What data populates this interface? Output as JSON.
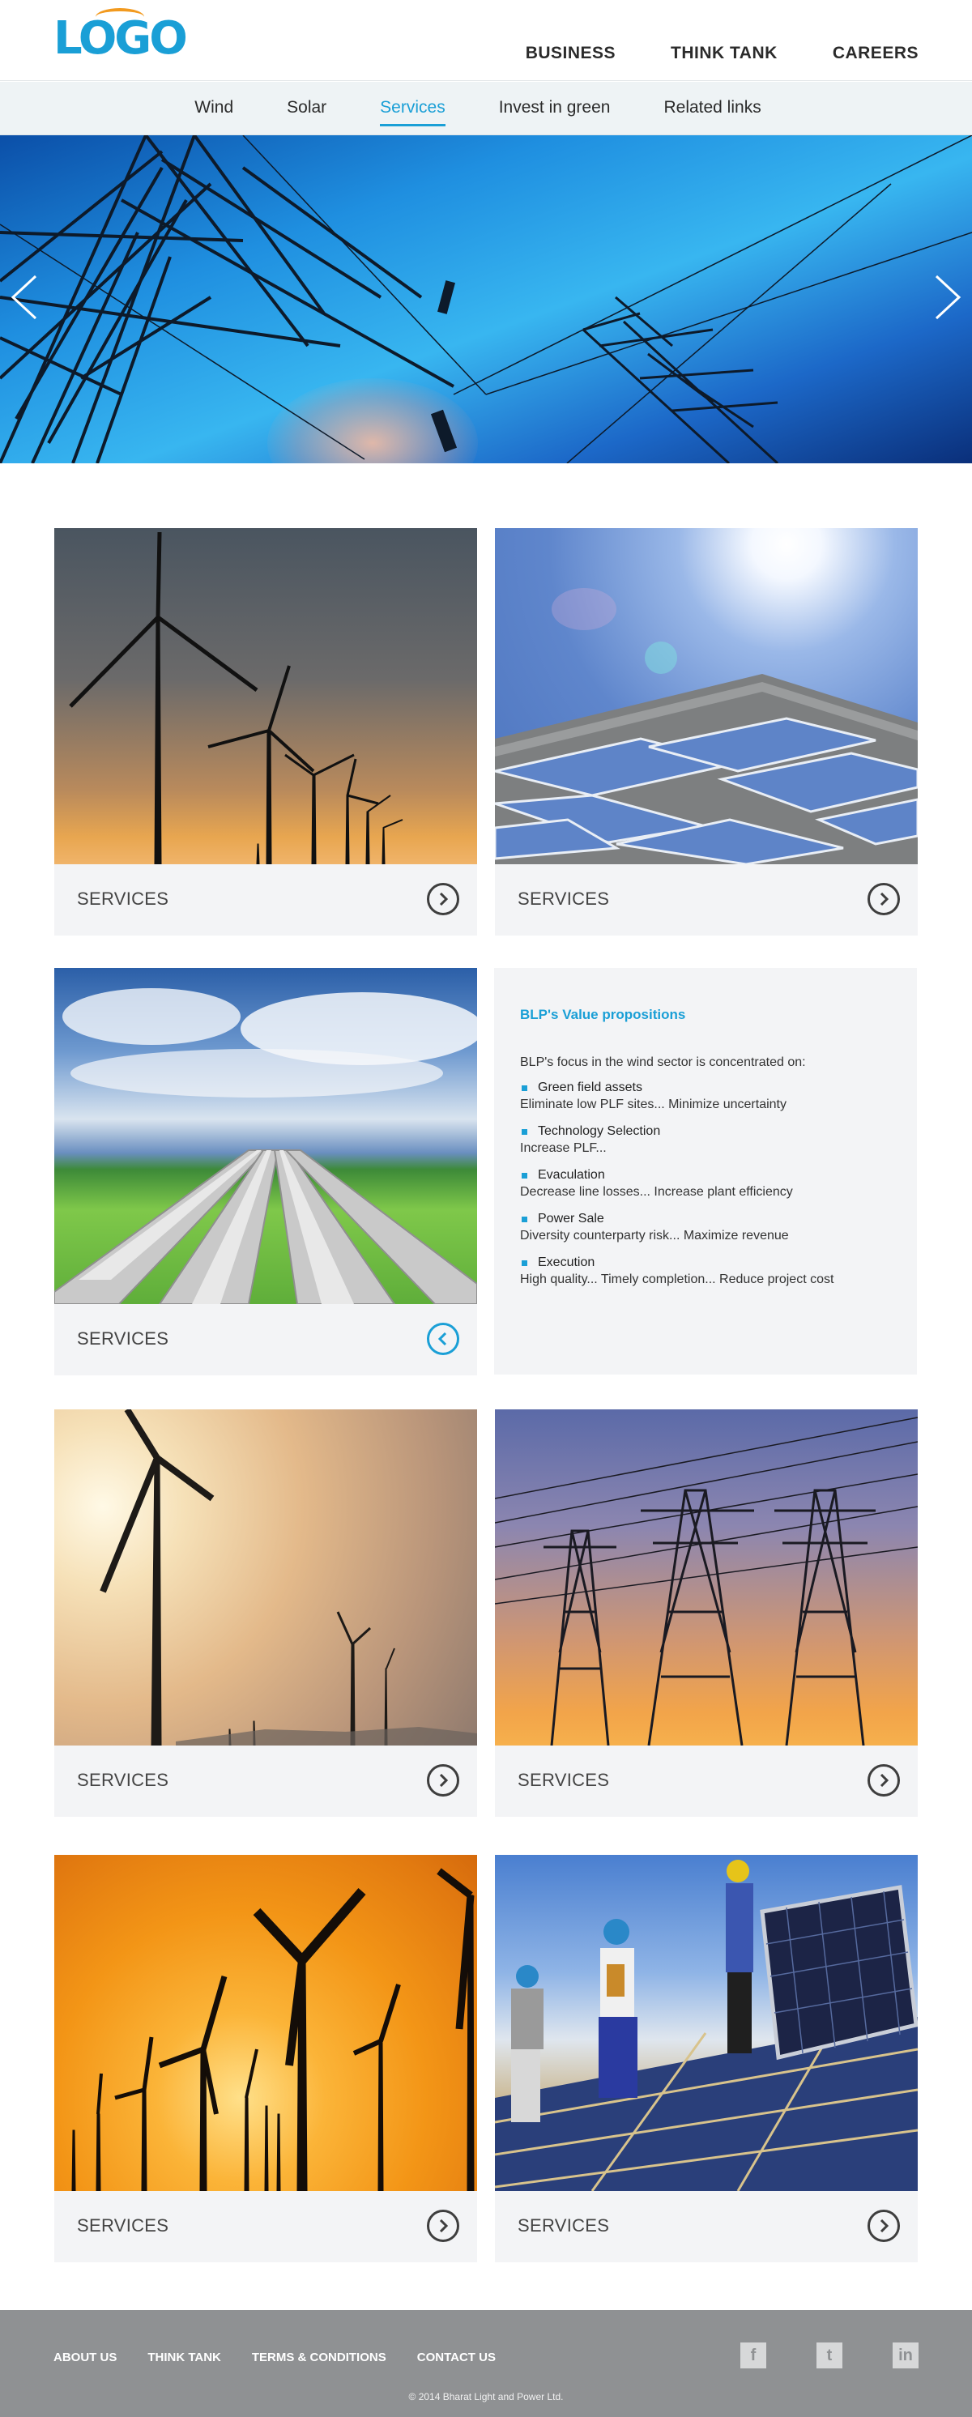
{
  "brand": {
    "logo_text": "LOGO",
    "primary_color": "#1a9fd6",
    "accent_color": "#f29a1f"
  },
  "top_nav": {
    "items": [
      "BUSINESS",
      "THINK TANK",
      "CAREERS"
    ]
  },
  "sub_nav": {
    "items": [
      "Wind",
      "Solar",
      "Services",
      "Invest in green",
      "Related links"
    ],
    "active": "Services"
  },
  "hero": {
    "prev_icon": "chevron-left-icon",
    "next_icon": "chevron-right-icon"
  },
  "cards": [
    {
      "label": "SERVICES",
      "image": "wind-turbines-dusk-photo",
      "action_icon": "chevron-right-icon"
    },
    {
      "label": "SERVICES",
      "image": "solar-panels-roof-photo",
      "action_icon": "chevron-right-icon"
    },
    {
      "label": "SERVICES",
      "image": "pipelines-field-photo",
      "action_icon": "chevron-left-icon"
    },
    {
      "label": "SERVICES",
      "image": "wind-turbine-sunset-photo",
      "action_icon": "chevron-right-icon"
    },
    {
      "label": "SERVICES",
      "image": "power-towers-sunset-photo",
      "action_icon": "chevron-right-icon"
    },
    {
      "label": "SERVICES",
      "image": "wind-farm-orange-photo",
      "action_icon": "chevron-right-icon"
    },
    {
      "label": "SERVICES",
      "image": "solar-installers-photo",
      "action_icon": "chevron-right-icon"
    }
  ],
  "value_panel": {
    "title": "BLP's Value propositions",
    "intro": "BLP's focus in the wind sector is concentrated on:",
    "items": [
      {
        "title": "Green field assets",
        "desc": "Eliminate low PLF sites... Minimize uncertainty"
      },
      {
        "title": "Technology Selection",
        "desc": "Increase PLF..."
      },
      {
        "title": "Evaculation",
        "desc": "Decrease line losses... Increase plant efficiency"
      },
      {
        "title": "Power Sale",
        "desc": "Diversity counterparty risk... Maximize revenue"
      },
      {
        "title": "Execution",
        "desc": "High quality... Timely completion... Reduce project cost"
      }
    ]
  },
  "footer": {
    "links": [
      "ABOUT US",
      "THINK TANK",
      "TERMS & CONDITIONS",
      "CONTACT US"
    ],
    "social": [
      {
        "icon": "facebook-icon",
        "glyph": "f"
      },
      {
        "icon": "twitter-icon",
        "glyph": "t"
      },
      {
        "icon": "linkedin-icon",
        "glyph": "in"
      }
    ],
    "copyright": "© 2014 Bharat Light and Power Ltd."
  }
}
